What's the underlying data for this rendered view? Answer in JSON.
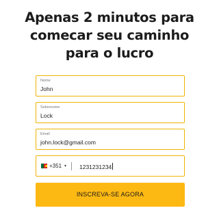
{
  "headline": {
    "line1": "Apenas 2 minutos para",
    "line2": "comecar seu caminho",
    "line3": "para o lucro"
  },
  "form": {
    "first_name": {
      "label": "Nome",
      "value": "John"
    },
    "last_name": {
      "label": "Sobrenome",
      "value": "Lock"
    },
    "email": {
      "label": "Email",
      "value": "john.lock@gmail.com"
    },
    "phone": {
      "flag": "portugal-flag-icon",
      "dial_code": "+351",
      "caret": "▾",
      "value": "1231231234"
    },
    "submit_label": "INSCREVA-SE AGORA"
  },
  "colors": {
    "accent": "#fdb913",
    "field_border": "#f0b400"
  }
}
